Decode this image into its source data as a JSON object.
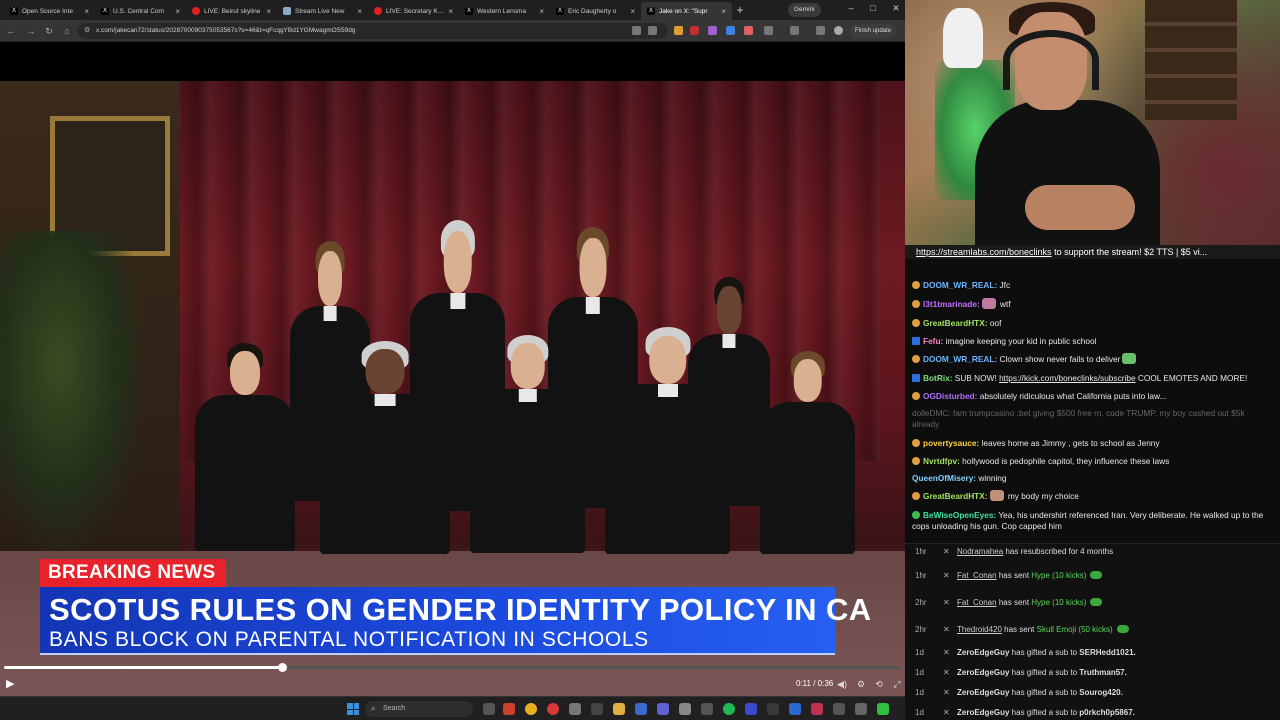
{
  "browser": {
    "tabs": [
      {
        "label": "Open Source Inte",
        "favicon": "x-icon"
      },
      {
        "label": "U.S. Central Com",
        "favicon": "x-icon"
      },
      {
        "label": "LIVE: Beirut skyline",
        "favicon": "youtube-icon"
      },
      {
        "label": "Stream Live New",
        "favicon": "stream-icon"
      },
      {
        "label": "LIVE: Secretary Kristi",
        "favicon": "youtube-icon"
      },
      {
        "label": "Western Lensma",
        "favicon": "x-icon"
      },
      {
        "label": "Eric Daugherty o",
        "favicon": "x-icon"
      },
      {
        "label": "Jake on X: \"Supr",
        "favicon": "x-icon"
      }
    ],
    "active_tab": 7,
    "gemini_label": "Gemini",
    "url": "x.com/jakecan72/status/2028700090375053567s?s=46&t=qFcqgYBd1YGMwagmOS59dg",
    "finish_update_label": "Finish update"
  },
  "video": {
    "breaking_label": "BREAKING NEWS",
    "headline": "SCOTUS RULES ON GENDER IDENTITY POLICY IN CA",
    "subheadline": "BANS BLOCK ON PARENTAL NOTIFICATION IN SCHOOLS",
    "time": "0:11 / 0:36",
    "progress_fraction": 0.31
  },
  "taskbar": {
    "search_placeholder": "Search"
  },
  "chat": {
    "banner_link": "https://streamlabs.com/boneclinks",
    "banner_text": " to support the stream! $2 TTS | $5 vi...",
    "messages": [
      {
        "user": "DOOM_WR_REAL:",
        "text": " Jfc",
        "color": "#6fb4ff",
        "badge": "round"
      },
      {
        "user": "l3t1tmarinade:",
        "text": " wtf",
        "color": "#c070ff",
        "badge": "round",
        "emote": "pink"
      },
      {
        "user": "GreatBeardHTX:",
        "text": " oof",
        "color": "#a0e060",
        "badge": "round"
      },
      {
        "user": "Fefu:",
        "text": " imagine keeping your kid in public school",
        "color": "#ff80c0",
        "badge": "square"
      },
      {
        "user": "DOOM_WR_REAL:",
        "text": " Clown show never fails to deliver",
        "color": "#6fb4ff",
        "badge": "round",
        "emote": "green"
      },
      {
        "user": "BotRix:",
        "text": " SUB NOW! ",
        "link": "https://kick.com/boneclinks/subscribe",
        "tail": " COOL EMOTES AND MORE!",
        "color": "#7ae07a",
        "badge": "square"
      },
      {
        "user": "OGDisturbed:",
        "text": " absolutely ridiculous what California puts into law...",
        "color": "#b070ff",
        "badge": "round"
      },
      {
        "user": "dolleDMC:",
        "text": " fam trumpcasino .bet giving $500 free rn, code TRUMP. my boy cashed out $5k already",
        "color": "#666666",
        "badge": "none",
        "faded": true
      },
      {
        "user": "povertysauce:",
        "text": " leaves home as Jimmy , gets to school as Jenny",
        "color": "#ffd040",
        "badge": "round"
      },
      {
        "user": "Nvrtdfpv:",
        "text": " hollywood is pedophile capitol, they influence these laws",
        "color": "#a0e060",
        "badge": "round"
      },
      {
        "user": "QueenOfMisery:",
        "text": " winning",
        "color": "#80d0ff",
        "badge": "none"
      },
      {
        "user": "GreatBeardHTX:",
        "text": " my body my choice",
        "color": "#a0e060",
        "badge": "round",
        "emote": "face"
      },
      {
        "user": "BeWiseOpenEyes:",
        "text": " Yea, his undershirt referenced Iran. Very deliberate. He walked up to the cops unloading his gun. Cop capped him",
        "color": "#40e0a0",
        "badge": "double"
      }
    ]
  },
  "events": [
    {
      "ago": "1hr",
      "name": "Nodramahea",
      "action": " has resubscribed for 4 months",
      "gift": "",
      "target": ""
    },
    {
      "ago": "1hr",
      "name": "Fat_Conan",
      "action": " has sent ",
      "gift": "Hype (10 kicks)",
      "target": ""
    },
    {
      "ago": "2hr",
      "name": "Fat_Conan",
      "action": " has sent ",
      "gift": "Hype (10 kicks)",
      "target": ""
    },
    {
      "ago": "2hr",
      "name": "Thedroid420",
      "action": " has sent ",
      "gift": "Skull Emoji (50 kicks)",
      "target": ""
    },
    {
      "ago": "1d",
      "name": "ZeroEdgeGuy",
      "action": " has gifted a sub to ",
      "gift": "",
      "target": "SERHedd1021."
    },
    {
      "ago": "1d",
      "name": "ZeroEdgeGuy",
      "action": " has gifted a sub to ",
      "gift": "",
      "target": "Truthman57."
    },
    {
      "ago": "1d",
      "name": "ZeroEdgeGuy",
      "action": " has gifted a sub to ",
      "gift": "",
      "target": "Sourog420."
    },
    {
      "ago": "1d",
      "name": "ZeroEdgeGuy",
      "action": " has gifted a sub to ",
      "gift": "",
      "target": "p0rkch0p5867."
    }
  ]
}
